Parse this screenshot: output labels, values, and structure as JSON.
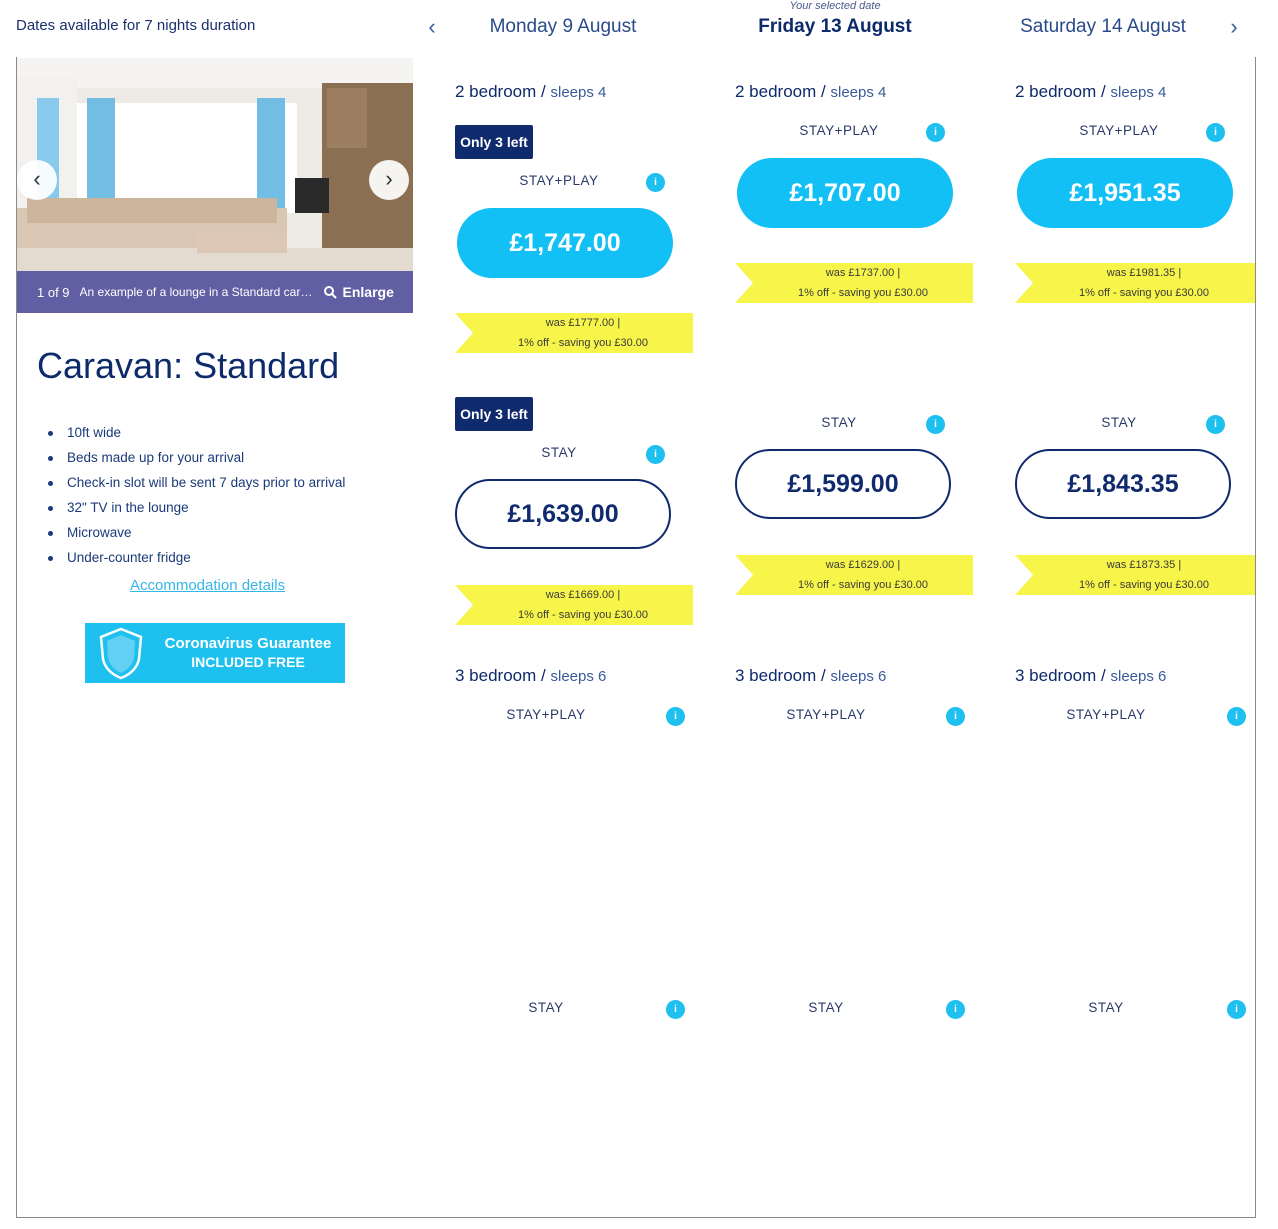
{
  "header": {
    "duration_text": "Dates available for 7 nights duration",
    "selected_note": "Your selected date",
    "prev_arrow": "‹",
    "next_arrow": "›",
    "dates": [
      "Monday 9 August",
      "Friday 13 August",
      "Saturday 14 August"
    ]
  },
  "gallery": {
    "count": "1 of 9",
    "caption": "An example of a lounge in a Standard caravan",
    "enlarge": "Enlarge",
    "prev": "‹",
    "next": "›"
  },
  "accommodation": {
    "title": "Caravan: Standard",
    "features": [
      "10ft wide",
      "Beds made up for your arrival",
      "Check-in slot will be sent 7 days prior to arrival",
      "32\" TV in the lounge",
      "Microwave",
      "Under-counter fridge"
    ],
    "details_link": "Accommodation details",
    "covid_line1": "Coronavirus Guarantee",
    "covid_line2": "INCLUDED FREE"
  },
  "labels": {
    "bed2": "2 bedroom",
    "bed3": "3 bedroom",
    "slash": "/",
    "sleeps4": "sleeps 4",
    "sleeps6": "sleeps 6",
    "stay_play": "STAY+PLAY",
    "stay": "STAY",
    "only_left": "Only 3 left",
    "info": "i"
  },
  "columns": [
    {
      "date": "Monday 9 August",
      "stay_play_price": "£1,747.00",
      "stay_play_was": "was £1777.00 |",
      "stay_play_off": "1% off - saving you £30.00",
      "stay_price": "£1,639.00",
      "stay_was": "was £1669.00 |",
      "stay_off": "1% off - saving you £30.00"
    },
    {
      "date": "Friday 13 August",
      "stay_play_price": "£1,707.00",
      "stay_play_was": "was £1737.00 |",
      "stay_play_off": "1% off - saving you £30.00",
      "stay_price": "£1,599.00",
      "stay_was": "was £1629.00 |",
      "stay_off": "1% off - saving you £30.00"
    },
    {
      "date": "Saturday 14 August",
      "stay_play_price": "£1,951.35",
      "stay_play_was": "was £1981.35 |",
      "stay_play_off": "1% off - saving you £30.00",
      "stay_price": "£1,843.35",
      "stay_was": "was £1873.35 |",
      "stay_off": "1% off - saving you £30.00"
    }
  ],
  "colors": {
    "navy": "#0d2a6b",
    "accent_blue": "#12c0f6",
    "saving_yellow": "#f7f54a",
    "badge_navy": "#102a6e"
  }
}
